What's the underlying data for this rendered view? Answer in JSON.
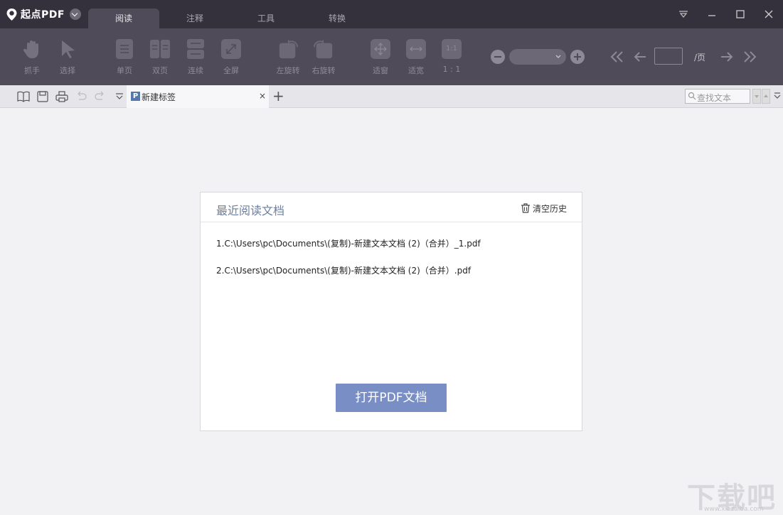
{
  "app": {
    "title": "起点PDF"
  },
  "top_tabs": [
    {
      "label": "阅读",
      "active": true
    },
    {
      "label": "注释",
      "active": false
    },
    {
      "label": "工具",
      "active": false
    },
    {
      "label": "转换",
      "active": false
    }
  ],
  "toolbar": {
    "grab": "抓手",
    "select": "选择",
    "single_page": "单页",
    "double_page": "双页",
    "continuous": "连续",
    "fullscreen": "全屏",
    "rotate_left": "左旋转",
    "rotate_right": "右旋转",
    "fit_window": "适窗",
    "fit_width": "适宽",
    "actual_size": "1 : 1",
    "actual_icon": "1:1",
    "page_suffix": "/页"
  },
  "tab_strip": {
    "doc_tab_label": "新建标签",
    "doc_tab_icon": "P",
    "close": "×",
    "new_tab": "+",
    "search_placeholder": "查找文本"
  },
  "recent": {
    "title": "最近阅读文档",
    "clear_label": "清空历史",
    "items": [
      "1.C:\\Users\\pc\\Documents\\(复制)-新建文本文档 (2)（合并）_1.pdf",
      "2.C:\\Users\\pc\\Documents\\(复制)-新建文本文档 (2)（合并）.pdf"
    ],
    "open_button": "打开PDF文档"
  },
  "watermark": {
    "text": "下载吧",
    "sub": "www.xiazaiba.com"
  },
  "colors": {
    "titlebar": "#34313d",
    "ribbon": "#4f4b59",
    "accent": "#7a8ec6",
    "panel_title": "#6d7f9e"
  }
}
